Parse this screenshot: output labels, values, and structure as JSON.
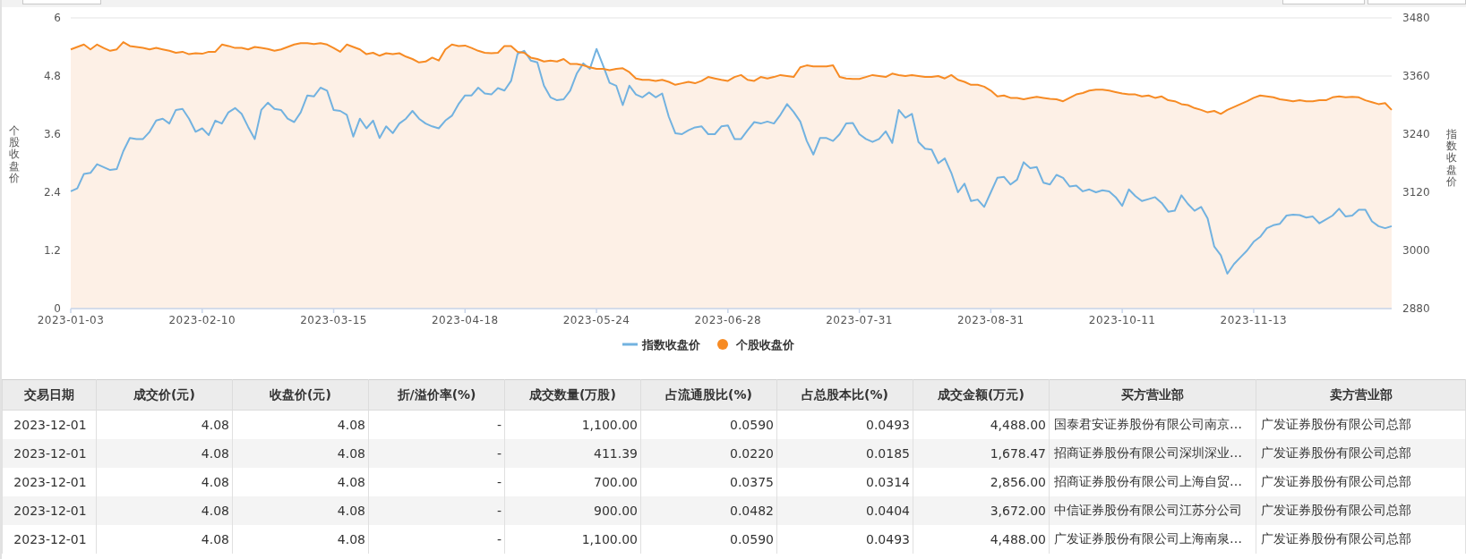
{
  "chart": {
    "chart_data": {
      "type": "line",
      "legend": "bottom",
      "ylabel": "个股收盘价",
      "y2label": "指数收盘价",
      "categories": [
        "2023-01-03",
        null,
        null,
        null,
        null,
        null,
        null,
        null,
        null,
        null,
        null,
        null,
        null,
        null,
        null,
        null,
        null,
        null,
        null,
        null,
        "2023-02-10",
        null,
        null,
        null,
        null,
        null,
        null,
        null,
        null,
        null,
        null,
        null,
        null,
        null,
        null,
        null,
        null,
        null,
        null,
        null,
        "2023-03-15",
        null,
        null,
        null,
        null,
        null,
        null,
        null,
        null,
        null,
        null,
        null,
        null,
        null,
        null,
        null,
        null,
        null,
        null,
        null,
        "2023-04-18",
        null,
        null,
        null,
        null,
        null,
        null,
        null,
        null,
        null,
        null,
        null,
        null,
        null,
        null,
        null,
        null,
        null,
        null,
        null,
        "2023-05-24",
        null,
        null,
        null,
        null,
        null,
        null,
        null,
        null,
        null,
        null,
        null,
        null,
        null,
        null,
        null,
        null,
        null,
        null,
        null,
        "2023-06-28",
        null,
        null,
        null,
        null,
        null,
        null,
        null,
        null,
        null,
        null,
        null,
        null,
        null,
        null,
        null,
        null,
        null,
        null,
        null,
        "2023-07-31",
        null,
        null,
        null,
        null,
        null,
        null,
        null,
        null,
        null,
        null,
        null,
        null,
        null,
        null,
        null,
        null,
        null,
        null,
        null,
        "2023-08-31",
        null,
        null,
        null,
        null,
        null,
        null,
        null,
        null,
        null,
        null,
        null,
        null,
        null,
        null,
        null,
        null,
        null,
        null,
        null,
        "2023-10-11",
        null,
        null,
        null,
        null,
        null,
        null,
        null,
        null,
        null,
        null,
        null,
        null,
        null,
        null,
        null,
        null,
        null,
        null,
        null,
        "2023-11-13",
        null,
        null,
        null,
        null,
        null,
        null,
        null,
        null,
        null,
        null,
        null,
        null,
        null,
        null,
        null,
        null,
        null,
        null,
        null,
        null,
        null
      ],
      "ylim": [
        0,
        6
      ],
      "yticks": [
        0,
        1.2,
        2.4,
        3.6,
        4.8,
        6
      ],
      "y2lim": [
        2880,
        3480
      ],
      "y2ticks": [
        2880,
        3000,
        3120,
        3240,
        3360,
        3480
      ],
      "series": [
        {
          "name": "指数收盘价",
          "color": "#72b2e0",
          "axis": "y2",
          "values": [
            3122,
            3128,
            3158,
            3160,
            3178,
            3172,
            3166,
            3168,
            3205,
            3232,
            3230,
            3230,
            3245,
            3268,
            3272,
            3262,
            3290,
            3292,
            3272,
            3245,
            3252,
            3238,
            3268,
            3262,
            3285,
            3294,
            3282,
            3255,
            3230,
            3290,
            3305,
            3292,
            3290,
            3272,
            3265,
            3285,
            3320,
            3318,
            3336,
            3330,
            3290,
            3288,
            3280,
            3235,
            3272,
            3252,
            3268,
            3232,
            3256,
            3242,
            3262,
            3272,
            3288,
            3272,
            3262,
            3256,
            3252,
            3268,
            3278,
            3302,
            3320,
            3320,
            3336,
            3324,
            3322,
            3335,
            3330,
            3350,
            3406,
            3412,
            3392,
            3388,
            3340,
            3316,
            3310,
            3312,
            3330,
            3365,
            3386,
            3375,
            3416,
            3382,
            3346,
            3340,
            3300,
            3340,
            3322,
            3316,
            3326,
            3316,
            3324,
            3276,
            3242,
            3240,
            3248,
            3254,
            3256,
            3240,
            3240,
            3256,
            3258,
            3230,
            3230,
            3248,
            3265,
            3262,
            3266,
            3262,
            3280,
            3302,
            3286,
            3266,
            3226,
            3198,
            3232,
            3232,
            3226,
            3240,
            3262,
            3263,
            3240,
            3230,
            3224,
            3230,
            3246,
            3222,
            3290,
            3274,
            3282,
            3224,
            3210,
            3208,
            3180,
            3190,
            3160,
            3120,
            3138,
            3102,
            3105,
            3090,
            3120,
            3150,
            3152,
            3136,
            3146,
            3182,
            3170,
            3172,
            3140,
            3136,
            3156,
            3150,
            3132,
            3134,
            3122,
            3126,
            3120,
            3124,
            3122,
            3110,
            3092,
            3126,
            3112,
            3102,
            3106,
            3110,
            3098,
            3080,
            3082,
            3114,
            3096,
            3082,
            3090,
            3066,
            3008,
            2990,
            2952,
            2972,
            2986,
            3000,
            3018,
            3028,
            3046,
            3052,
            3055,
            3072,
            3074,
            3073,
            3068,
            3070,
            3056,
            3064,
            3072,
            3086,
            3070,
            3072,
            3084,
            3084,
            3060,
            3050,
            3046,
            3050
          ]
        },
        {
          "name": "个股收盘价",
          "color": "#f78b24",
          "values": [
            5.35,
            5.4,
            5.45,
            5.35,
            5.45,
            5.38,
            5.32,
            5.35,
            5.5,
            5.42,
            5.4,
            5.38,
            5.35,
            5.38,
            5.35,
            5.32,
            5.28,
            5.3,
            5.25,
            5.27,
            5.26,
            5.3,
            5.3,
            5.45,
            5.42,
            5.38,
            5.38,
            5.35,
            5.4,
            5.38,
            5.36,
            5.32,
            5.35,
            5.4,
            5.45,
            5.48,
            5.48,
            5.46,
            5.48,
            5.45,
            5.38,
            5.3,
            5.45,
            5.4,
            5.35,
            5.25,
            5.28,
            5.22,
            5.27,
            5.25,
            5.27,
            5.2,
            5.15,
            5.08,
            5.1,
            5.18,
            5.12,
            5.35,
            5.45,
            5.42,
            5.43,
            5.38,
            5.32,
            5.28,
            5.27,
            5.28,
            5.42,
            5.42,
            5.3,
            5.28,
            5.18,
            5.15,
            5.1,
            5.12,
            5.1,
            5.15,
            5.05,
            5.05,
            5.02,
            4.98,
            4.95,
            4.95,
            4.92,
            4.95,
            4.96,
            4.88,
            4.75,
            4.72,
            4.72,
            4.7,
            4.72,
            4.68,
            4.62,
            4.65,
            4.68,
            4.65,
            4.7,
            4.78,
            4.75,
            4.72,
            4.7,
            4.78,
            4.82,
            4.72,
            4.7,
            4.78,
            4.75,
            4.78,
            4.82,
            4.8,
            4.78,
            4.98,
            5.02,
            5.0,
            5.0,
            5.0,
            5.02,
            4.78,
            4.75,
            4.74,
            4.74,
            4.78,
            4.82,
            4.8,
            4.78,
            4.85,
            4.82,
            4.8,
            4.82,
            4.8,
            4.78,
            4.78,
            4.8,
            4.75,
            4.82,
            4.72,
            4.68,
            4.62,
            4.62,
            4.58,
            4.5,
            4.38,
            4.4,
            4.35,
            4.35,
            4.32,
            4.35,
            4.37,
            4.35,
            4.33,
            4.32,
            4.28,
            4.35,
            4.42,
            4.45,
            4.5,
            4.52,
            4.52,
            4.5,
            4.47,
            4.44,
            4.42,
            4.42,
            4.38,
            4.4,
            4.35,
            4.38,
            4.3,
            4.28,
            4.22,
            4.2,
            4.14,
            4.1,
            4.05,
            4.08,
            4.02,
            4.1,
            4.16,
            4.22,
            4.28,
            4.35,
            4.4,
            4.38,
            4.36,
            4.32,
            4.3,
            4.28,
            4.3,
            4.28,
            4.28,
            4.3,
            4.3,
            4.36,
            4.38,
            4.36,
            4.37,
            4.36,
            4.3,
            4.26,
            4.22,
            4.24,
            4.1
          ]
        }
      ]
    }
  },
  "table": {
    "columns": [
      {
        "label": "交易日期",
        "kind": "date"
      },
      {
        "label": "成交价(元)",
        "kind": "number"
      },
      {
        "label": "收盘价(元)",
        "kind": "number"
      },
      {
        "label": "折/溢价率(%)",
        "kind": "number"
      },
      {
        "label": "成交数量(万股)",
        "kind": "number"
      },
      {
        "label": "占流通股比(%)",
        "kind": "number"
      },
      {
        "label": "占总股本比(%)",
        "kind": "number"
      },
      {
        "label": "成交金额(万元)",
        "kind": "number"
      },
      {
        "label": "买方营业部",
        "kind": "text"
      },
      {
        "label": "卖方营业部",
        "kind": "text"
      }
    ],
    "rows": [
      [
        "2023-12-01",
        "4.08",
        "4.08",
        "-",
        "1,100.00",
        "0.0590",
        "0.0493",
        "4,488.00",
        "国泰君安证券股份有限公司南京…",
        "广发证券股份有限公司总部"
      ],
      [
        "2023-12-01",
        "4.08",
        "4.08",
        "-",
        "411.39",
        "0.0220",
        "0.0185",
        "1,678.47",
        "招商证券股份有限公司深圳深业…",
        "广发证券股份有限公司总部"
      ],
      [
        "2023-12-01",
        "4.08",
        "4.08",
        "-",
        "700.00",
        "0.0375",
        "0.0314",
        "2,856.00",
        "招商证券股份有限公司上海自贸…",
        "广发证券股份有限公司总部"
      ],
      [
        "2023-12-01",
        "4.08",
        "4.08",
        "-",
        "900.00",
        "0.0482",
        "0.0404",
        "3,672.00",
        "中信证券股份有限公司江苏分公司",
        "广发证券股份有限公司总部"
      ],
      [
        "2023-12-01",
        "4.08",
        "4.08",
        "-",
        "1,100.00",
        "0.0590",
        "0.0493",
        "4,488.00",
        "广发证券股份有限公司上海南泉…",
        "广发证券股份有限公司总部"
      ]
    ]
  }
}
